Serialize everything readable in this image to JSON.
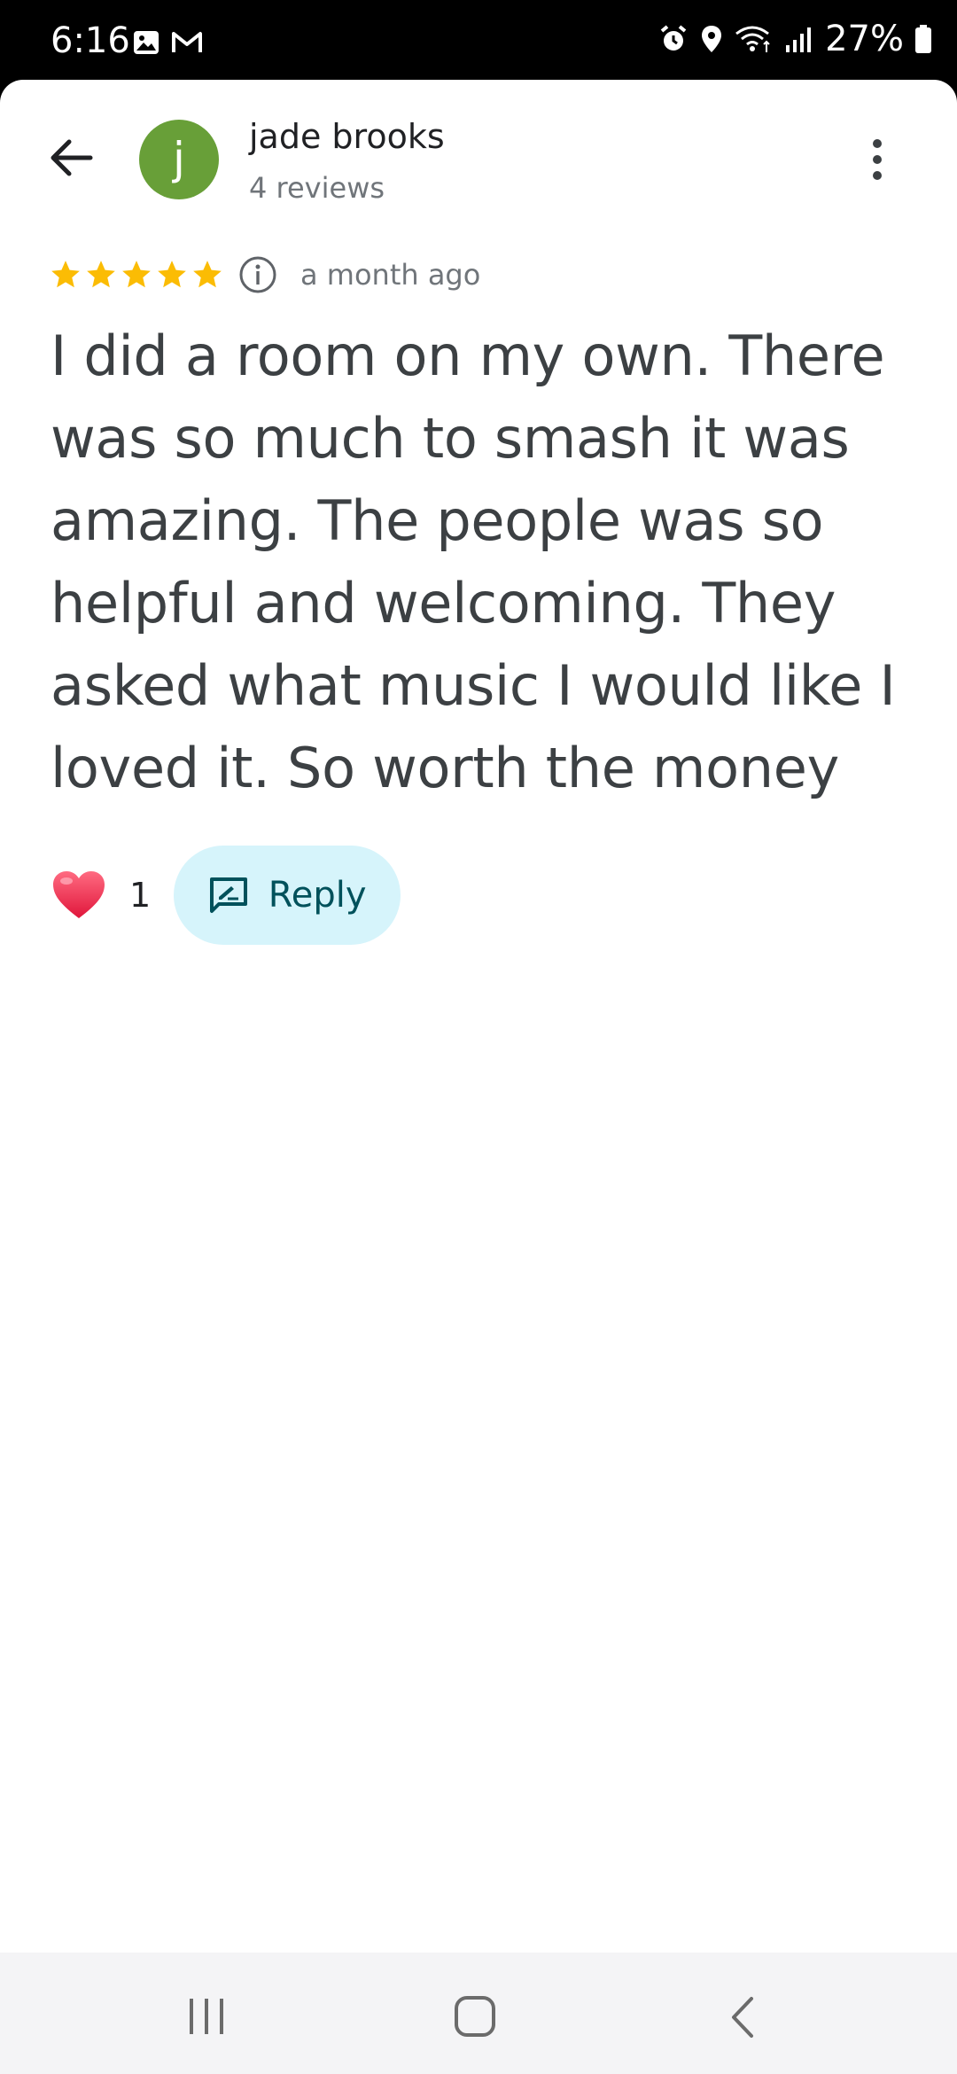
{
  "status_bar": {
    "time": "6:16",
    "battery": "27%"
  },
  "review": {
    "author": {
      "name": "jade brooks",
      "initial": "j",
      "meta": "4 reviews",
      "avatar_color": "#689f38"
    },
    "rating": 5,
    "date": "a month ago",
    "text": "I did a room on my own. There was so much to smash it was amazing. The people was so helpful and welcoming. They asked what music I would like I loved it. So worth the money",
    "likes": "1",
    "reply_label": "Reply"
  },
  "colors": {
    "star": "#fbbc04",
    "reply_bg": "#d6f4fb",
    "reply_fg": "#00515b"
  },
  "icons": [
    "back-arrow-icon",
    "more-vert-icon",
    "info-icon",
    "heart-icon",
    "reply-icon",
    "recents-icon",
    "home-icon",
    "nav-back-icon"
  ]
}
